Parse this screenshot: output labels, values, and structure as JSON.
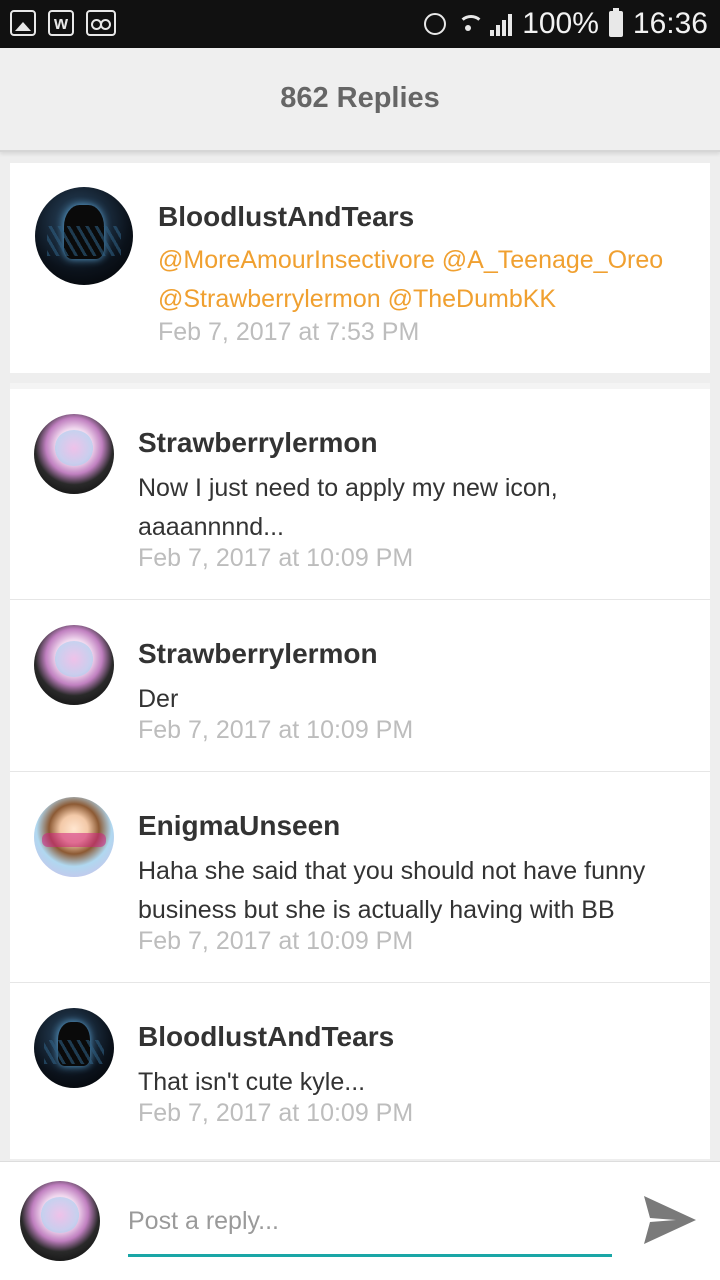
{
  "status_bar": {
    "battery": "100%",
    "time": "16:36",
    "icons": [
      "image-icon",
      "wattpad-icon",
      "voicemail-icon",
      "alarm-icon",
      "wifi-icon",
      "signal-icon",
      "battery-icon"
    ]
  },
  "header": {
    "title": "862 Replies"
  },
  "original_post": {
    "user": "BloodlustAndTears",
    "mentions_line1": "@MoreAmourInsectivore @A_Teenage_Oreo",
    "mentions_line2": "@Strawberrylermon @TheDumbKK",
    "time": "Feb 7, 2017 at 7:53 PM"
  },
  "replies": [
    {
      "user": "Strawberrylermon",
      "body_line1": "Now I just need to apply my new icon,",
      "body_line2": "aaaannnnd...",
      "time": "Feb 7, 2017 at 10:09 PM"
    },
    {
      "user": "Strawberrylermon",
      "body_line1": "Der",
      "body_line2": "",
      "time": "Feb 7, 2017 at 10:09 PM"
    },
    {
      "user": "EnigmaUnseen",
      "body_line1": "Haha she said that you should not have funny",
      "body_line2": "business but she is actually having with BB",
      "time": "Feb 7, 2017 at 10:09 PM"
    },
    {
      "user": "BloodlustAndTears",
      "body_line1": "That isn't cute kyle...",
      "body_line2": "",
      "time": "Feb 7, 2017 at 10:09 PM"
    }
  ],
  "reply_bar": {
    "placeholder": "Post a reply...",
    "send_icon": "send-icon"
  },
  "colors": {
    "mention": "#f0a030",
    "accent": "#1aa6a6",
    "timestamp": "#bdbdbd"
  }
}
